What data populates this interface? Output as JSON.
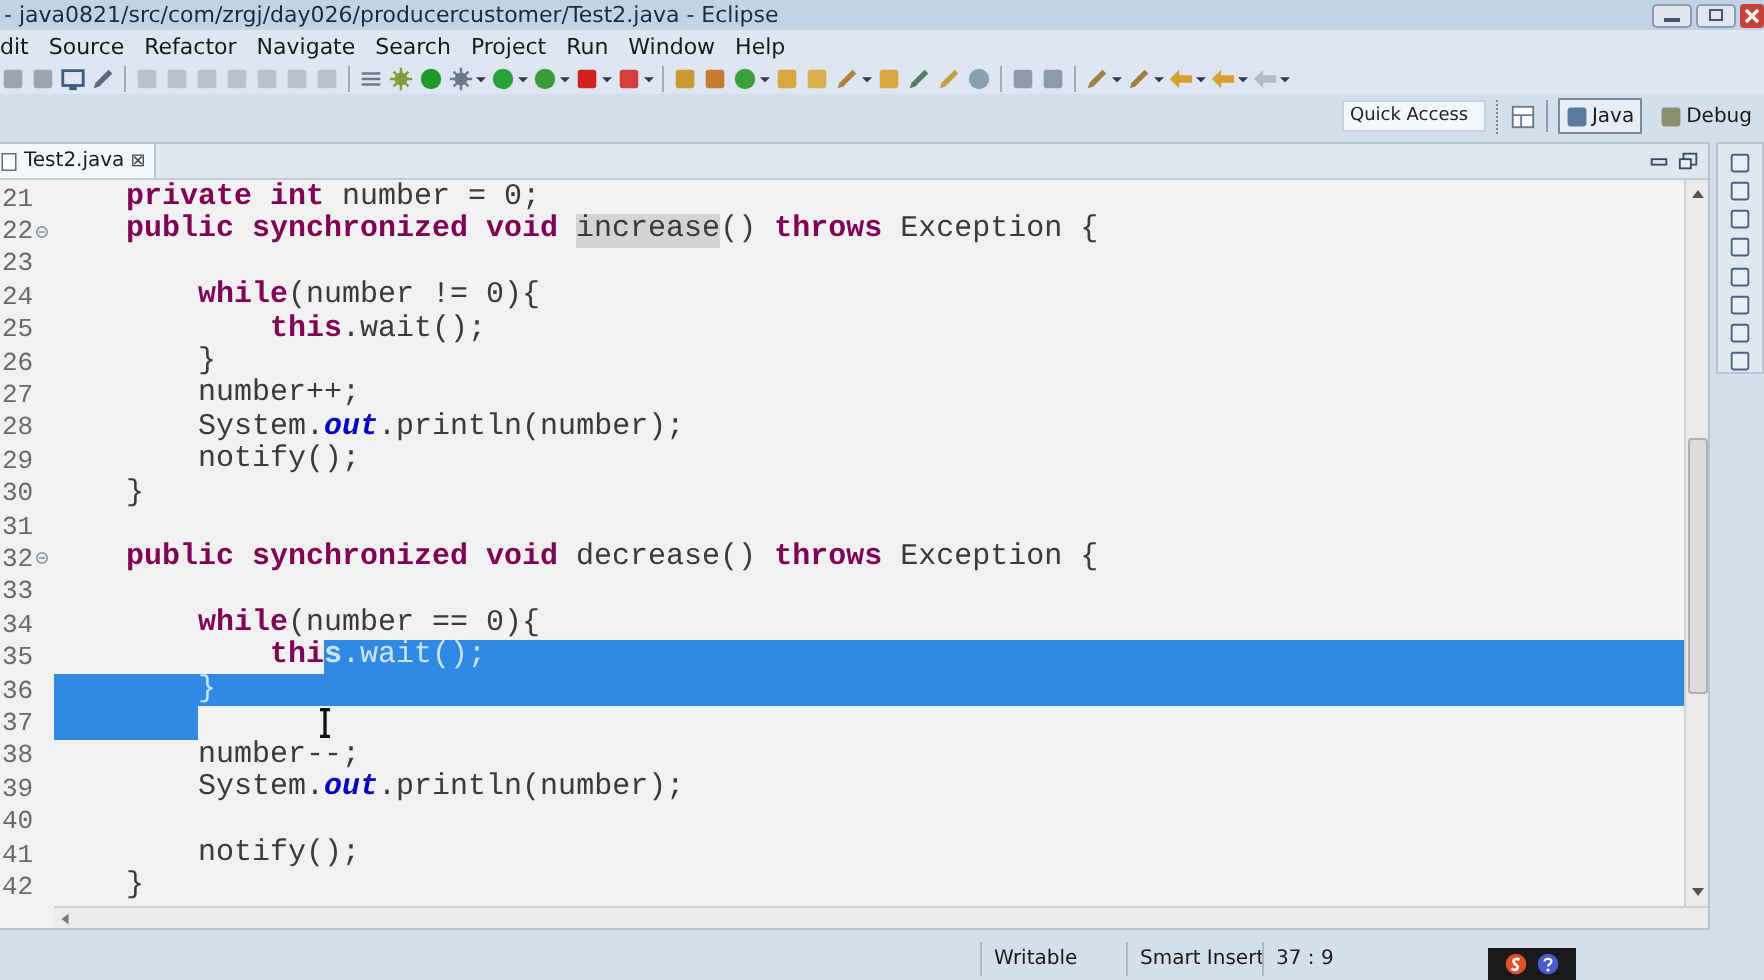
{
  "window": {
    "title": "- java0821/src/com/zrgj/day026/producercustomer/Test2.java - Eclipse"
  },
  "menu": [
    "dit",
    "Source",
    "Refactor",
    "Navigate",
    "Search",
    "Project",
    "Run",
    "Window",
    "Help"
  ],
  "quick_access": {
    "placeholder": "Quick Access"
  },
  "perspectives": [
    {
      "label": "Java",
      "selected": true
    },
    {
      "label": "Debug",
      "selected": false
    }
  ],
  "editor_tab": {
    "label": "Test2.java",
    "close": "⊠"
  },
  "lines": [
    {
      "number": "21",
      "foldable": false,
      "selection_to_end": false,
      "indent_selected": false,
      "tokens": [
        {
          "kind": "keyword",
          "text": "    private",
          "selected": false
        },
        {
          "kind": "keyword",
          "text": " int",
          "selected": false
        },
        {
          "kind": "plain",
          "text": " number = 0;",
          "selected": false
        }
      ]
    },
    {
      "number": "22",
      "foldable": true,
      "selection_to_end": false,
      "indent_selected": false,
      "tokens": [
        {
          "kind": "keyword",
          "text": "    public synchronized void ",
          "selected": false
        },
        {
          "kind": "occurrence",
          "text": "increase",
          "selected": false
        },
        {
          "kind": "plain",
          "text": "() ",
          "selected": false
        },
        {
          "kind": "keyword",
          "text": "throws",
          "selected": false
        },
        {
          "kind": "plain",
          "text": " Exception {",
          "selected": false
        }
      ]
    },
    {
      "number": "23",
      "foldable": false,
      "selection_to_end": false,
      "indent_selected": false
    },
    {
      "number": "24",
      "foldable": false,
      "selection_to_end": false,
      "indent_selected": false,
      "tokens": [
        {
          "kind": "keyword",
          "text": "        while",
          "selected": false
        },
        {
          "kind": "plain",
          "text": "(number != 0){",
          "selected": false
        }
      ]
    },
    {
      "number": "25",
      "foldable": false,
      "selection_to_end": false,
      "indent_selected": false,
      "tokens": [
        {
          "kind": "keyword",
          "text": "            this",
          "selected": false
        },
        {
          "kind": "plain",
          "text": ".wait();",
          "selected": false
        }
      ]
    },
    {
      "number": "26",
      "foldable": false,
      "selection_to_end": false,
      "indent_selected": false,
      "tokens": [
        {
          "kind": "plain",
          "text": "        }",
          "selected": false
        }
      ]
    },
    {
      "number": "27",
      "foldable": false,
      "selection_to_end": false,
      "indent_selected": false,
      "tokens": [
        {
          "kind": "plain",
          "text": "        number++;",
          "selected": false
        }
      ]
    },
    {
      "number": "28",
      "foldable": false,
      "selection_to_end": false,
      "indent_selected": false,
      "tokens": [
        {
          "kind": "plain",
          "text": "        System.",
          "selected": false
        },
        {
          "kind": "field",
          "text": "out",
          "selected": false
        },
        {
          "kind": "plain",
          "text": ".println(number);",
          "selected": false
        }
      ]
    },
    {
      "number": "29",
      "foldable": false,
      "selection_to_end": false,
      "indent_selected": false,
      "tokens": [
        {
          "kind": "plain",
          "text": "        notify();",
          "selected": false
        }
      ]
    },
    {
      "number": "30",
      "foldable": false,
      "selection_to_end": false,
      "indent_selected": false,
      "tokens": [
        {
          "kind": "plain",
          "text": "    }",
          "selected": false
        }
      ]
    },
    {
      "number": "31",
      "foldable": false,
      "selection_to_end": false,
      "indent_selected": false
    },
    {
      "number": "32",
      "foldable": true,
      "selection_to_end": false,
      "indent_selected": false,
      "tokens": [
        {
          "kind": "keyword",
          "text": "    public synchronized void",
          "selected": false
        },
        {
          "kind": "plain",
          "text": " decrease() ",
          "selected": false
        },
        {
          "kind": "keyword",
          "text": "throws",
          "selected": false
        },
        {
          "kind": "plain",
          "text": " Exception {",
          "selected": false
        }
      ]
    },
    {
      "number": "33",
      "foldable": false,
      "selection_to_end": false,
      "indent_selected": false
    },
    {
      "number": "34",
      "foldable": false,
      "selection_to_end": false,
      "indent_selected": false,
      "tokens": [
        {
          "kind": "keyword",
          "text": "        while",
          "selected": false
        },
        {
          "kind": "plain",
          "text": "(number == 0){",
          "selected": false
        }
      ]
    },
    {
      "number": "35",
      "foldable": false,
      "selection_to_end": true,
      "indent_selected": false,
      "tokens": [
        {
          "kind": "keyword",
          "text": "            thi",
          "selected": false
        },
        {
          "kind": "keyword",
          "text": "s",
          "selected": true
        },
        {
          "kind": "plain",
          "text": ".wait();",
          "selected": true
        }
      ]
    },
    {
      "number": "36",
      "foldable": false,
      "selection_to_end": true,
      "indent_selected": false,
      "tokens": [
        {
          "kind": "plain",
          "text": "        }",
          "selected": true
        }
      ]
    },
    {
      "number": "37",
      "foldable": false,
      "selection_to_end": false,
      "indent_selected": true
    },
    {
      "number": "38",
      "foldable": false,
      "selection_to_end": false,
      "indent_selected": false,
      "tokens": [
        {
          "kind": "plain",
          "text": "        number--;",
          "selected": false
        }
      ]
    },
    {
      "number": "39",
      "foldable": false,
      "selection_to_end": false,
      "indent_selected": false,
      "tokens": [
        {
          "kind": "plain",
          "text": "        System.",
          "selected": false
        },
        {
          "kind": "field",
          "text": "out",
          "selected": false
        },
        {
          "kind": "plain",
          "text": ".println(number);",
          "selected": false
        }
      ]
    },
    {
      "number": "40",
      "foldable": false,
      "selection_to_end": false,
      "indent_selected": false
    },
    {
      "number": "41",
      "foldable": false,
      "selection_to_end": false,
      "indent_selected": false,
      "tokens": [
        {
          "kind": "plain",
          "text": "        notify();",
          "selected": false
        }
      ]
    },
    {
      "number": "42",
      "foldable": false,
      "selection_to_end": false,
      "indent_selected": false,
      "tokens": [
        {
          "kind": "plain",
          "text": "    }",
          "selected": false
        }
      ]
    }
  ],
  "status_bar": {
    "mode": "Writable",
    "insert": "Smart Insert",
    "position": "37 : 9"
  }
}
